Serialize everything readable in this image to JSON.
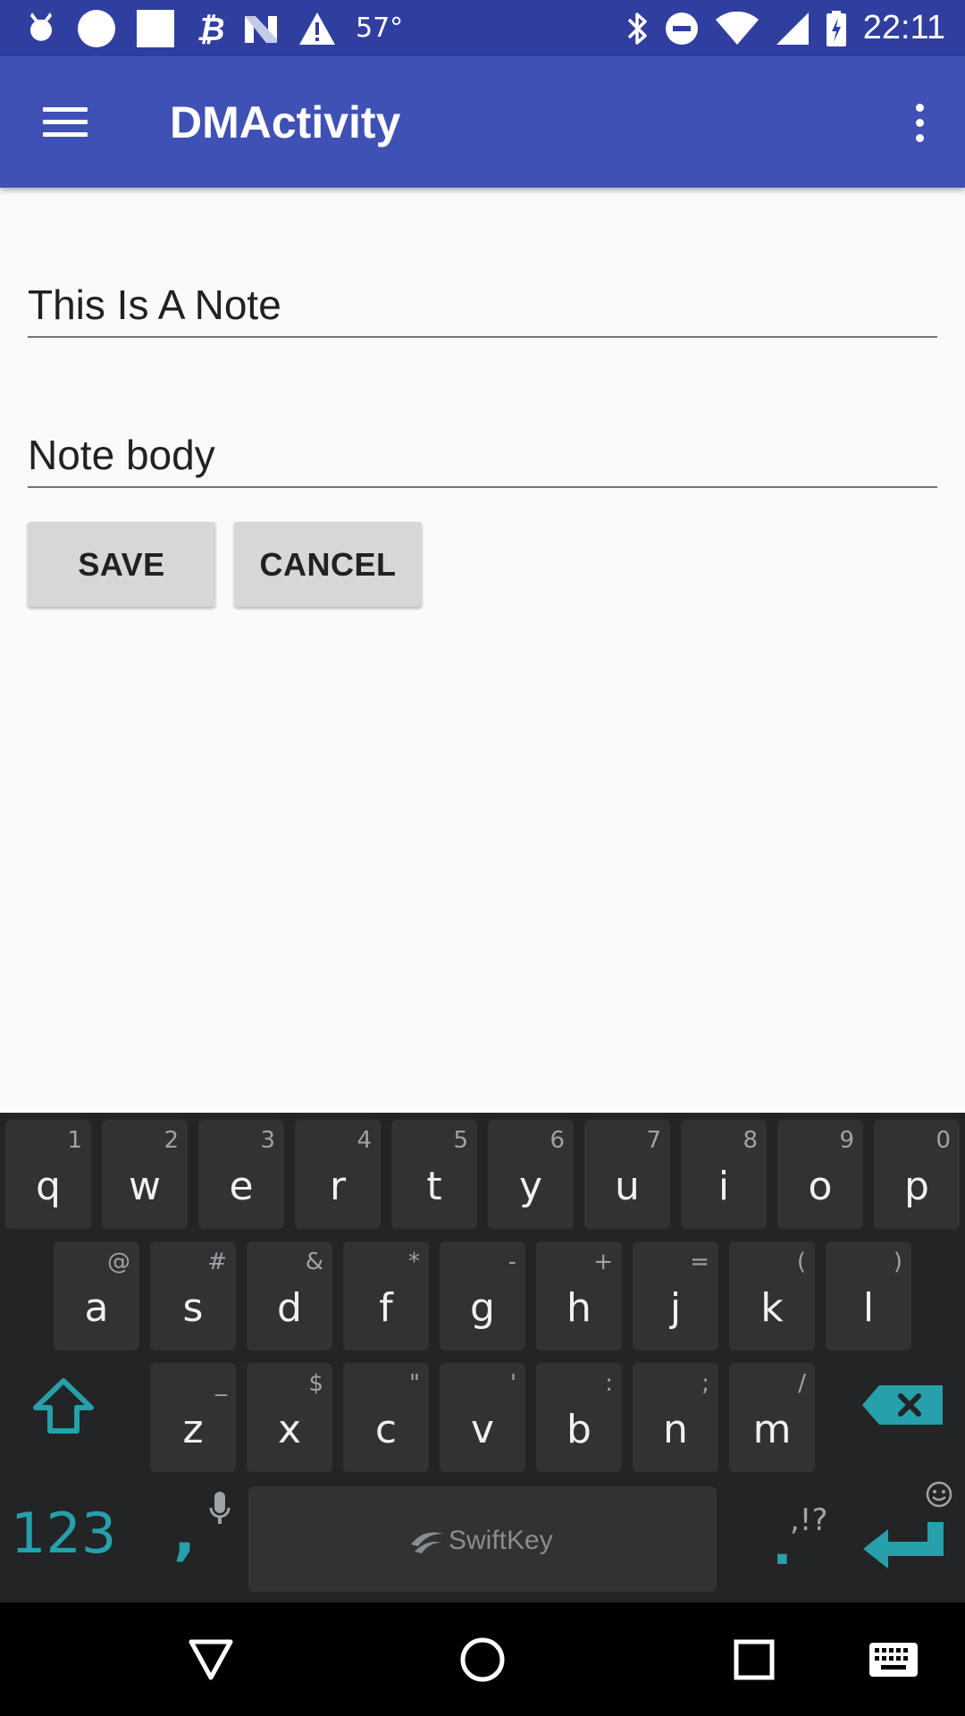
{
  "status_bar": {
    "temperature": "57°",
    "time": "22:11",
    "left_icons": [
      "notification-app-icon",
      "circle-icon",
      "square-icon",
      "bitcoin-icon",
      "n-app-icon",
      "warning-icon"
    ],
    "right_icons": [
      "bluetooth-icon",
      "do-not-disturb-icon",
      "wifi-icon",
      "cell-signal-icon",
      "battery-charging-icon"
    ]
  },
  "app_bar": {
    "title": "DMActivity",
    "menu_icon": "hamburger-menu-icon",
    "overflow_icon": "more-vert-icon"
  },
  "form": {
    "title_value": "This Is A Note",
    "body_value": "Note body",
    "save_label": "SAVE",
    "cancel_label": "CANCEL"
  },
  "keyboard": {
    "brand": "SwiftKey",
    "row1": [
      {
        "key": "q",
        "hint": "1"
      },
      {
        "key": "w",
        "hint": "2"
      },
      {
        "key": "e",
        "hint": "3"
      },
      {
        "key": "r",
        "hint": "4"
      },
      {
        "key": "t",
        "hint": "5"
      },
      {
        "key": "y",
        "hint": "6"
      },
      {
        "key": "u",
        "hint": "7"
      },
      {
        "key": "i",
        "hint": "8"
      },
      {
        "key": "o",
        "hint": "9"
      },
      {
        "key": "p",
        "hint": "0"
      }
    ],
    "row2": [
      {
        "key": "a",
        "hint": "@"
      },
      {
        "key": "s",
        "hint": "#"
      },
      {
        "key": "d",
        "hint": "&"
      },
      {
        "key": "f",
        "hint": "*"
      },
      {
        "key": "g",
        "hint": "-"
      },
      {
        "key": "h",
        "hint": "+"
      },
      {
        "key": "j",
        "hint": "="
      },
      {
        "key": "k",
        "hint": "("
      },
      {
        "key": "l",
        "hint": ")"
      }
    ],
    "row3": [
      {
        "key": "z",
        "hint": "_"
      },
      {
        "key": "x",
        "hint": "$"
      },
      {
        "key": "c",
        "hint": "\""
      },
      {
        "key": "v",
        "hint": "'"
      },
      {
        "key": "b",
        "hint": ":"
      },
      {
        "key": "n",
        "hint": ";"
      },
      {
        "key": "m",
        "hint": "/"
      }
    ],
    "numbers_label": "123",
    "comma_label": ",",
    "period_label": ".",
    "period_hint": ",!?",
    "shift_icon": "shift-icon",
    "backspace_icon": "backspace-icon",
    "mic_icon": "mic-icon",
    "emoji_icon": "emoji-icon",
    "enter_icon": "enter-icon"
  },
  "nav_bar": {
    "back_icon": "back-triangle-icon",
    "home_icon": "home-circle-icon",
    "recents_icon": "recents-square-icon",
    "keyboard_icon": "keyboard-icon"
  },
  "colors": {
    "status_bar": "#303f9f",
    "app_bar": "#3f51b5",
    "keyboard_accent": "#26a0aa",
    "keyboard_bg": "#222426"
  }
}
